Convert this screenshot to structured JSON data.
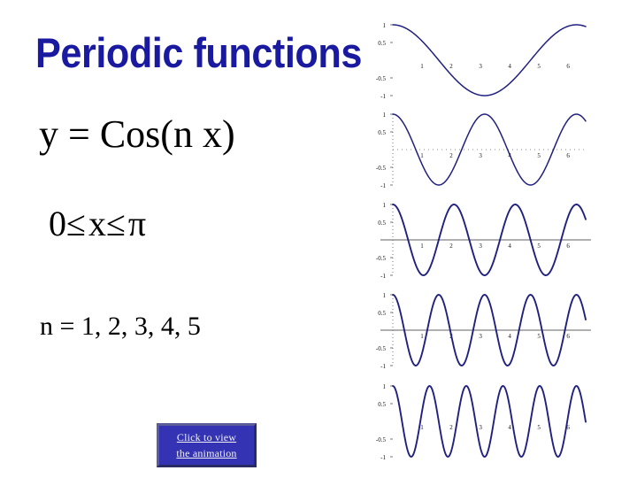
{
  "slide": {
    "title": "Periodic  functions",
    "equation_function": "y = Cos(n x)",
    "equation_domain_left": "0",
    "equation_domain_rel1": "≤",
    "equation_domain_var": "x",
    "equation_domain_rel2": "≤",
    "equation_domain_right": "π",
    "parameter_values": "n = 1, 2, 3, 4, 5",
    "title_color": "#1a1aa0",
    "text_color": "#000000",
    "background_color": "#ffffff"
  },
  "button": {
    "line1": "Click to view",
    "line2": "the animation",
    "background_color": "#3333b3",
    "text_color": "#f2f2f2"
  },
  "chart_data": [
    {
      "type": "line",
      "title": "",
      "name": "cos(1x)",
      "n": 1,
      "xlabel": "",
      "ylabel": "",
      "xlim": [
        0,
        6.6
      ],
      "ylim": [
        -1,
        1
      ],
      "xticks": [
        1,
        2,
        3,
        4,
        5,
        6
      ],
      "xtick_labels": [
        "1",
        "2",
        "3",
        "4",
        "5",
        "6"
      ],
      "yticks": [
        1,
        0.5,
        -0.5,
        -1
      ],
      "ytick_labels": [
        "1",
        "0.5",
        "-0.5",
        "-1"
      ],
      "grid": false,
      "axis_line": false,
      "line_color": "#202080",
      "series": [
        {
          "name": "cos(x)",
          "expression": "Cos(1 x)",
          "cycles": 1,
          "amplitude": 1
        }
      ]
    },
    {
      "type": "line",
      "title": "",
      "name": "cos(2x)",
      "n": 2,
      "xlabel": "",
      "ylabel": "",
      "xlim": [
        0,
        6.6
      ],
      "ylim": [
        -1,
        1
      ],
      "xticks": [
        1,
        2,
        3,
        4,
        5,
        6
      ],
      "xtick_labels": [
        "1",
        "2",
        "3",
        "4",
        "5",
        "6"
      ],
      "yticks": [
        1,
        0.5,
        -0.5,
        -1
      ],
      "ytick_labels": [
        "1",
        "0.5",
        "-0.5",
        "-1"
      ],
      "grid": true,
      "axis_line": false,
      "line_color": "#202080",
      "series": [
        {
          "name": "cos(2x)",
          "expression": "Cos(2 x)",
          "cycles": 2,
          "amplitude": 1
        }
      ]
    },
    {
      "type": "line",
      "title": "",
      "name": "cos(3x)",
      "n": 3,
      "xlabel": "",
      "ylabel": "",
      "xlim": [
        0,
        6.6
      ],
      "ylim": [
        -1,
        1
      ],
      "xticks": [
        1,
        2,
        3,
        4,
        5,
        6
      ],
      "xtick_labels": [
        "1",
        "2",
        "3",
        "4",
        "5",
        "6"
      ],
      "yticks": [
        1,
        0.5,
        -0.5,
        -1
      ],
      "ytick_labels": [
        "1",
        "0.5",
        "-0.5",
        "-1"
      ],
      "grid": true,
      "axis_line": true,
      "line_color": "#202080",
      "series": [
        {
          "name": "cos(3x)",
          "expression": "Cos(3 x)",
          "cycles": 3,
          "amplitude": 1
        }
      ]
    },
    {
      "type": "line",
      "title": "",
      "name": "cos(4x)",
      "n": 4,
      "xlabel": "",
      "ylabel": "",
      "xlim": [
        0,
        6.6
      ],
      "ylim": [
        -1,
        1
      ],
      "xticks": [
        1,
        2,
        3,
        4,
        5,
        6
      ],
      "xtick_labels": [
        "1",
        "2",
        "3",
        "4",
        "5",
        "6"
      ],
      "yticks": [
        1,
        0.5,
        -0.5,
        -1
      ],
      "ytick_labels": [
        "1",
        "0.5",
        "-0.5",
        "-1"
      ],
      "grid": true,
      "axis_line": true,
      "line_color": "#202080",
      "series": [
        {
          "name": "cos(4x)",
          "expression": "Cos(4 x)",
          "cycles": 4,
          "amplitude": 1
        }
      ]
    },
    {
      "type": "line",
      "title": "",
      "name": "cos(5x)",
      "n": 5,
      "xlabel": "",
      "ylabel": "",
      "xlim": [
        0,
        6.6
      ],
      "ylim": [
        -1,
        1
      ],
      "xticks": [
        1,
        2,
        3,
        4,
        5,
        6
      ],
      "xtick_labels": [
        "1",
        "2",
        "3",
        "4",
        "5",
        "6"
      ],
      "yticks": [
        1,
        0.5,
        -0.5,
        -1
      ],
      "ytick_labels": [
        "1",
        "0.5",
        "-0.5",
        "-1"
      ],
      "grid": false,
      "axis_line": false,
      "line_color": "#202080",
      "series": [
        {
          "name": "cos(5x)",
          "expression": "Cos(5 x)",
          "cycles": 5,
          "amplitude": 1
        }
      ]
    }
  ]
}
